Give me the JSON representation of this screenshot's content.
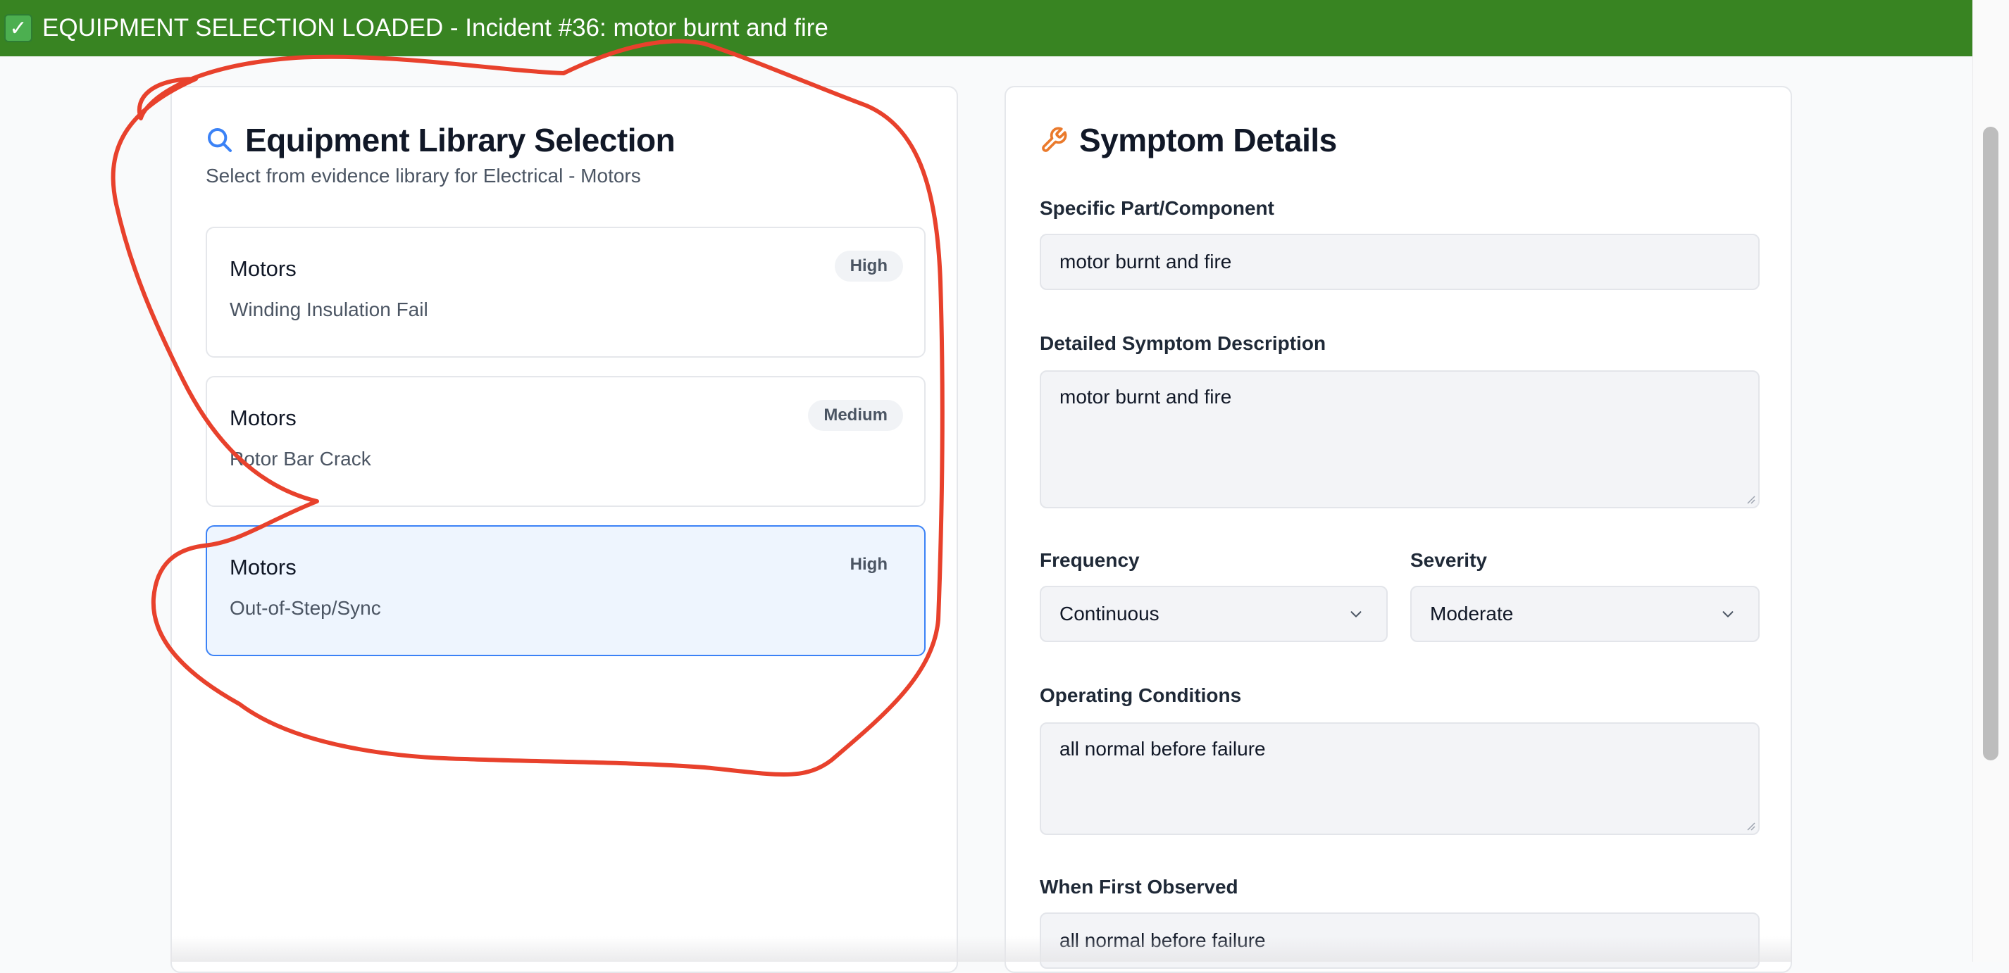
{
  "banner": {
    "check_glyph": "✓",
    "text": "EQUIPMENT SELECTION LOADED - Incident #36: motor burnt and fire",
    "color": "#388422"
  },
  "library": {
    "title": "Equipment Library Selection",
    "icon": "search-icon",
    "subtitle": "Select from evidence library for Electrical - Motors",
    "items": [
      {
        "name": "Motors",
        "description": "Winding Insulation Fail",
        "priority": "High",
        "selected": false
      },
      {
        "name": "Motors",
        "description": "Rotor Bar Crack",
        "priority": "Medium",
        "selected": false
      },
      {
        "name": "Motors",
        "description": "Out-of-Step/Sync",
        "priority": "High",
        "selected": true
      }
    ]
  },
  "symptom": {
    "title": "Symptom Details",
    "icon": "wrench-icon",
    "part_label": "Specific Part/Component",
    "part_value": "motor burnt and fire",
    "description_label": "Detailed Symptom Description",
    "description_value": "motor burnt and fire",
    "frequency_label": "Frequency",
    "frequency_value": "Continuous",
    "severity_label": "Severity",
    "severity_value": "Moderate",
    "conditions_label": "Operating Conditions",
    "conditions_value": "all normal before failure",
    "first_observed_label": "When First Observed",
    "first_observed_value": "all normal before failure"
  },
  "colors": {
    "accent": "#3b82f6",
    "wrench": "#ea7a2c",
    "annotation": "#e8412c"
  }
}
